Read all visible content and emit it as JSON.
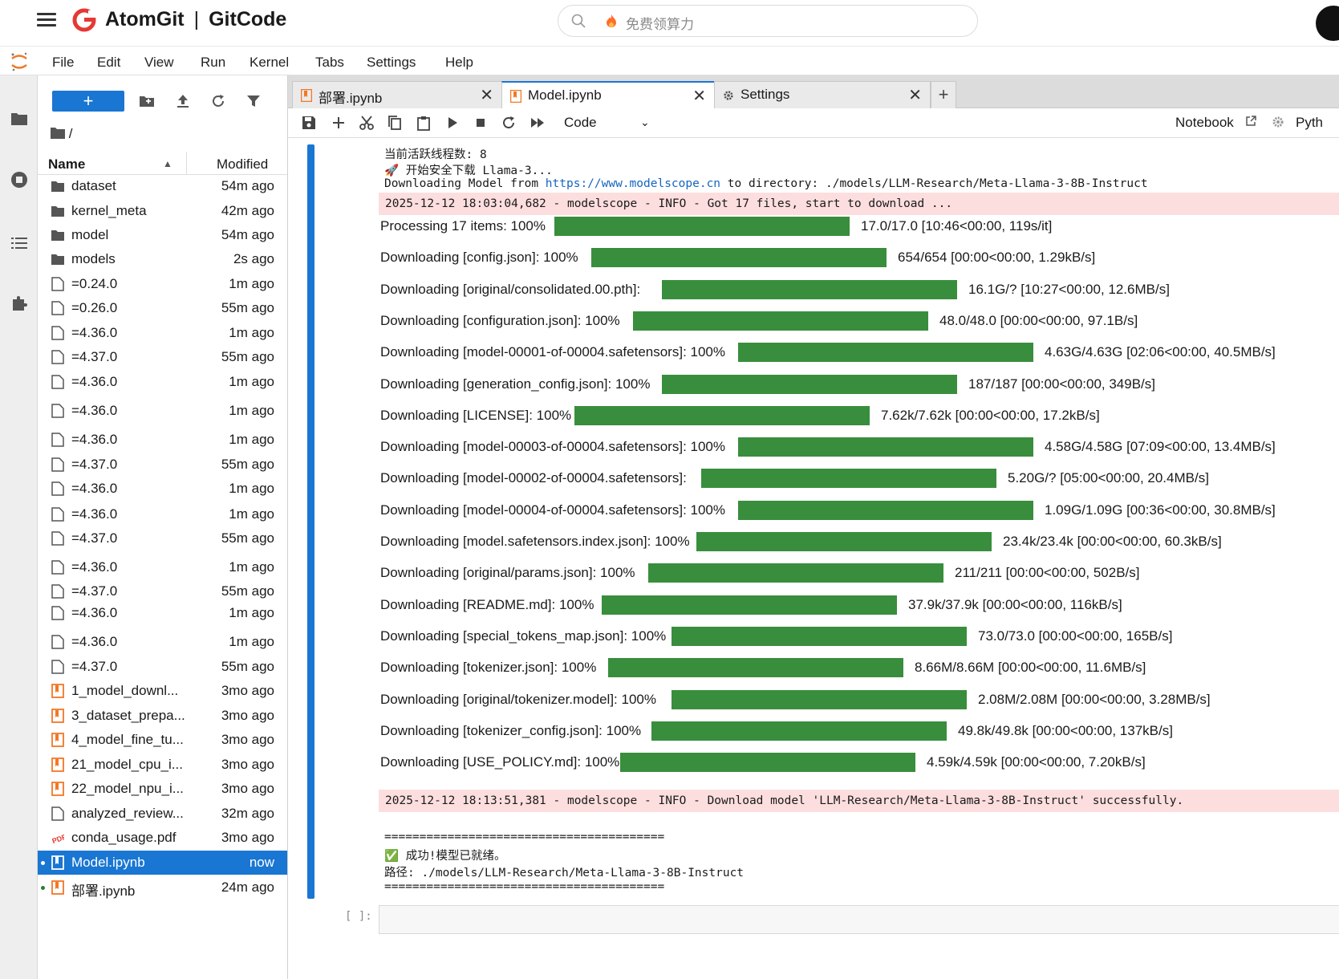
{
  "topbar": {
    "brand_left": "AtomGit",
    "brand_sep": "|",
    "brand_right": "GitCode",
    "search_placeholder": "免费领算力"
  },
  "menu": [
    "File",
    "Edit",
    "View",
    "Run",
    "Kernel",
    "Tabs",
    "Settings",
    "Help"
  ],
  "filebrowser": {
    "new_button": "+",
    "breadcrumb": "/",
    "col_name": "Name",
    "col_modified": "Modified",
    "files": [
      {
        "name": "dataset",
        "modified": "54m ago",
        "type": "folder"
      },
      {
        "name": "kernel_meta",
        "modified": "42m ago",
        "type": "folder"
      },
      {
        "name": "model",
        "modified": "54m ago",
        "type": "folder"
      },
      {
        "name": "models",
        "modified": "2s ago",
        "type": "folder"
      },
      {
        "name": "=0.24.0",
        "modified": "1m ago",
        "type": "file"
      },
      {
        "name": "=0.26.0",
        "modified": "55m ago",
        "type": "file"
      },
      {
        "name": "=4.36.0",
        "modified": "1m ago",
        "type": "file"
      },
      {
        "name": "=4.37.0",
        "modified": "55m ago",
        "type": "file"
      },
      {
        "name": "=4.36.0",
        "modified": "1m ago",
        "type": "file"
      },
      {
        "name": "=4.36.0",
        "modified": "1m ago",
        "type": "file"
      },
      {
        "name": "=4.36.0",
        "modified": "1m ago",
        "type": "file"
      },
      {
        "name": "=4.37.0",
        "modified": "55m ago",
        "type": "file"
      },
      {
        "name": "=4.36.0",
        "modified": "1m ago",
        "type": "file"
      },
      {
        "name": "=4.36.0",
        "modified": "1m ago",
        "type": "file"
      },
      {
        "name": "=4.37.0",
        "modified": "55m ago",
        "type": "file"
      },
      {
        "name": "=4.36.0",
        "modified": "1m ago",
        "type": "file"
      },
      {
        "name": "=4.37.0",
        "modified": "55m ago",
        "type": "file"
      },
      {
        "name": "=4.36.0",
        "modified": "1m ago",
        "type": "file"
      },
      {
        "name": "=4.36.0",
        "modified": "1m ago",
        "type": "file"
      },
      {
        "name": "=4.37.0",
        "modified": "55m ago",
        "type": "file"
      },
      {
        "name": "1_model_downl...",
        "modified": "3mo ago",
        "type": "notebook"
      },
      {
        "name": "3_dataset_prepa...",
        "modified": "3mo ago",
        "type": "notebook"
      },
      {
        "name": "4_model_fine_tu...",
        "modified": "3mo ago",
        "type": "notebook"
      },
      {
        "name": "21_model_cpu_i...",
        "modified": "3mo ago",
        "type": "notebook"
      },
      {
        "name": "22_model_npu_i...",
        "modified": "3mo ago",
        "type": "notebook"
      },
      {
        "name": "analyzed_review...",
        "modified": "32m ago",
        "type": "file"
      },
      {
        "name": "conda_usage.pdf",
        "modified": "3mo ago",
        "type": "pdf"
      },
      {
        "name": "Model.ipynb",
        "modified": "now",
        "type": "notebook",
        "selected": true,
        "running": true
      },
      {
        "name": "部署.ipynb",
        "modified": "24m ago",
        "type": "notebook",
        "running": true
      }
    ]
  },
  "tabs": [
    {
      "label": "部署.ipynb",
      "icon": "notebook-icon"
    },
    {
      "label": "Model.ipynb",
      "icon": "notebook-icon",
      "active": true
    },
    {
      "label": "Settings",
      "icon": "gear-icon"
    }
  ],
  "notebook_toolbar": {
    "cell_type": "Code",
    "kernel_label": "Notebook",
    "kernel_name": "Pyth"
  },
  "output": {
    "line1": "当前活跃线程数: 8",
    "line2": "🚀 开始安全下载 Llama-3...",
    "line3_prefix": "Downloading Model from ",
    "line3_link": "https://www.modelscope.cn",
    "line3_suffix": " to directory: ./models/LLM-Research/Meta-Llama-3-8B-Instruct",
    "log1": "2025-12-12 18:03:04,682 - modelscope - INFO - Got 17 files, start to download ...",
    "progress": [
      {
        "label": "Processing 17 items: 100%",
        "stat": "17.0/17.0 [10:46<00:00, 119s/it]",
        "fraction": 1.0
      },
      {
        "label": "Downloading [config.json]: 100%",
        "stat": "654/654 [00:00<00:00, 1.29kB/s]",
        "fraction": 1.0
      },
      {
        "label": "Downloading [original/consolidated.00.pth]:",
        "stat": "16.1G/? [10:27<00:00, 12.6MB/s]",
        "fraction": 1.0
      },
      {
        "label": "Downloading [configuration.json]: 100%",
        "stat": "48.0/48.0 [00:00<00:00, 97.1B/s]",
        "fraction": 1.0
      },
      {
        "label": "Downloading [model-00001-of-00004.safetensors]: 100%",
        "stat": "4.63G/4.63G [02:06<00:00, 40.5MB/s]",
        "fraction": 1.0
      },
      {
        "label": "Downloading [generation_config.json]: 100%",
        "stat": "187/187 [00:00<00:00, 349B/s]",
        "fraction": 1.0
      },
      {
        "label": "Downloading [LICENSE]: 100%",
        "stat": "7.62k/7.62k [00:00<00:00, 17.2kB/s]",
        "fraction": 1.0
      },
      {
        "label": "Downloading [model-00003-of-00004.safetensors]: 100%",
        "stat": "4.58G/4.58G [07:09<00:00, 13.4MB/s]",
        "fraction": 1.0
      },
      {
        "label": "Downloading [model-00002-of-00004.safetensors]:",
        "stat": "5.20G/? [05:00<00:00, 20.4MB/s]",
        "fraction": 1.0
      },
      {
        "label": "Downloading [model-00004-of-00004.safetensors]: 100%",
        "stat": "1.09G/1.09G [00:36<00:00, 30.8MB/s]",
        "fraction": 1.0
      },
      {
        "label": "Downloading [model.safetensors.index.json]: 100%",
        "stat": "23.4k/23.4k [00:00<00:00, 60.3kB/s]",
        "fraction": 1.0
      },
      {
        "label": "Downloading [original/params.json]: 100%",
        "stat": "211/211 [00:00<00:00, 502B/s]",
        "fraction": 1.0
      },
      {
        "label": "Downloading [README.md]: 100%",
        "stat": "37.9k/37.9k [00:00<00:00, 116kB/s]",
        "fraction": 1.0
      },
      {
        "label": "Downloading [special_tokens_map.json]: 100%",
        "stat": "73.0/73.0 [00:00<00:00, 165B/s]",
        "fraction": 1.0
      },
      {
        "label": "Downloading [tokenizer.json]: 100%",
        "stat": "8.66M/8.66M [00:00<00:00, 11.6MB/s]",
        "fraction": 1.0
      },
      {
        "label": "Downloading [original/tokenizer.model]: 100%",
        "stat": "2.08M/2.08M [00:00<00:00, 3.28MB/s]",
        "fraction": 1.0
      },
      {
        "label": "Downloading [tokenizer_config.json]: 100%",
        "stat": "49.8k/49.8k [00:00<00:00, 137kB/s]",
        "fraction": 1.0
      },
      {
        "label": "Downloading [USE_POLICY.md]: 100%",
        "stat": "4.59k/4.59k [00:00<00:00, 7.20kB/s]",
        "fraction": 1.0
      }
    ],
    "log2": "2025-12-12 18:13:51,381 - modelscope - INFO - Download model 'LLM-Research/Meta-Llama-3-8B-Instruct' successfully.",
    "rule": "========================================",
    "success": "✅ 成功!模型已就绪。",
    "path": "路径: ./models/LLM-Research/Meta-Llama-3-8B-Instruct"
  },
  "empty_cell_prompt": "[ ]:",
  "colors": {
    "accent": "#1976d2",
    "progress": "#388e3c",
    "stderr_bg": "#fddede",
    "brand_red": "#e53935"
  }
}
